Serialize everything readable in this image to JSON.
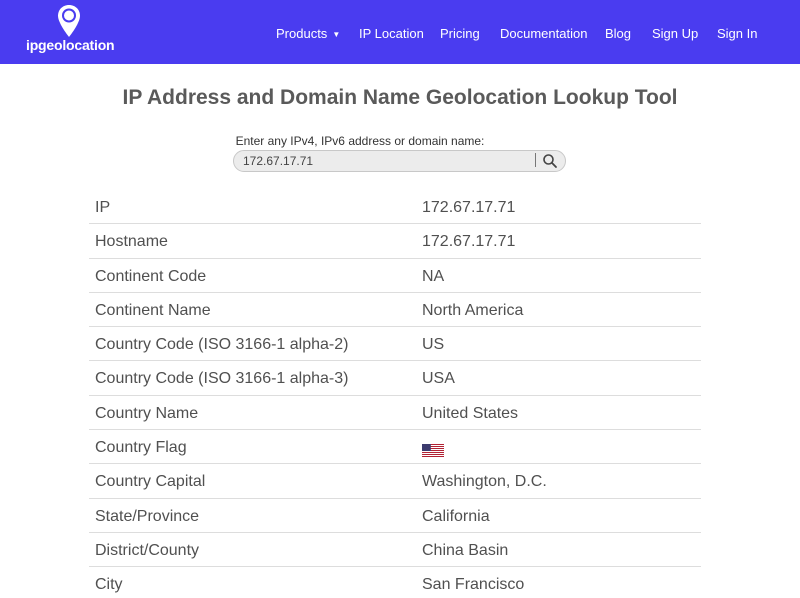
{
  "header": {
    "logo_text": "ipgeolocation",
    "brand_color": "#4a3cf0",
    "nav": [
      {
        "label": "Products",
        "has_dropdown": true
      },
      {
        "label": "IP Location"
      },
      {
        "label": "Pricing"
      },
      {
        "label": "Documentation"
      },
      {
        "label": "Blog"
      },
      {
        "label": "Sign Up"
      },
      {
        "label": "Sign In"
      }
    ]
  },
  "main": {
    "title": "IP Address and Domain Name Geolocation Lookup Tool",
    "search": {
      "label": "Enter any IPv4, IPv6 address or domain name:",
      "value": "172.67.17.71",
      "button_icon": "search-icon"
    },
    "rows": [
      {
        "label": "IP",
        "value": "172.67.17.71"
      },
      {
        "label": "Hostname",
        "value": "172.67.17.71"
      },
      {
        "label": "Continent Code",
        "value": "NA"
      },
      {
        "label": "Continent Name",
        "value": "North America"
      },
      {
        "label": "Country Code (ISO 3166-1 alpha-2)",
        "value": "US"
      },
      {
        "label": "Country Code (ISO 3166-1 alpha-3)",
        "value": "USA"
      },
      {
        "label": "Country Name",
        "value": "United States"
      },
      {
        "label": "Country Flag",
        "value": "",
        "icon": "us-flag-icon"
      },
      {
        "label": "Country Capital",
        "value": "Washington, D.C."
      },
      {
        "label": "State/Province",
        "value": "California"
      },
      {
        "label": "District/County",
        "value": "China Basin"
      },
      {
        "label": "City",
        "value": "San Francisco"
      }
    ]
  }
}
